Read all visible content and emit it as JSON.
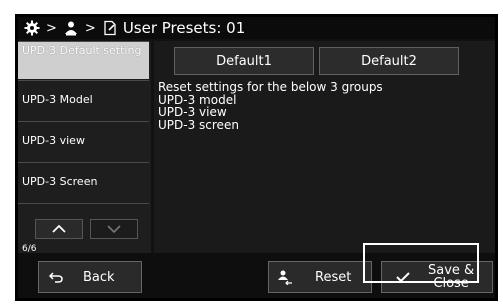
{
  "header": {
    "title": "User Presets: 01"
  },
  "sidebar": {
    "items": [
      {
        "label": "UPD-3 Default setting",
        "selected": true
      },
      {
        "label": "UPD-3 Model",
        "selected": false
      },
      {
        "label": "UPD-3 view",
        "selected": false
      },
      {
        "label": "UPD-3 Screen",
        "selected": false
      }
    ],
    "page_indicator": "6/6"
  },
  "main": {
    "tabs": [
      {
        "label": "Default1"
      },
      {
        "label": "Default2"
      }
    ],
    "description": "Reset settings for the below 3 groups\nUPD-3 model\nUPD-3 view\nUPD-3 screen"
  },
  "footer": {
    "back_label": "Back",
    "reset_label": "Reset",
    "save_label": "Save &\nClose"
  },
  "colors": {
    "background": "#111111",
    "selected": "#cfcfcf",
    "text": "#ffffff"
  }
}
